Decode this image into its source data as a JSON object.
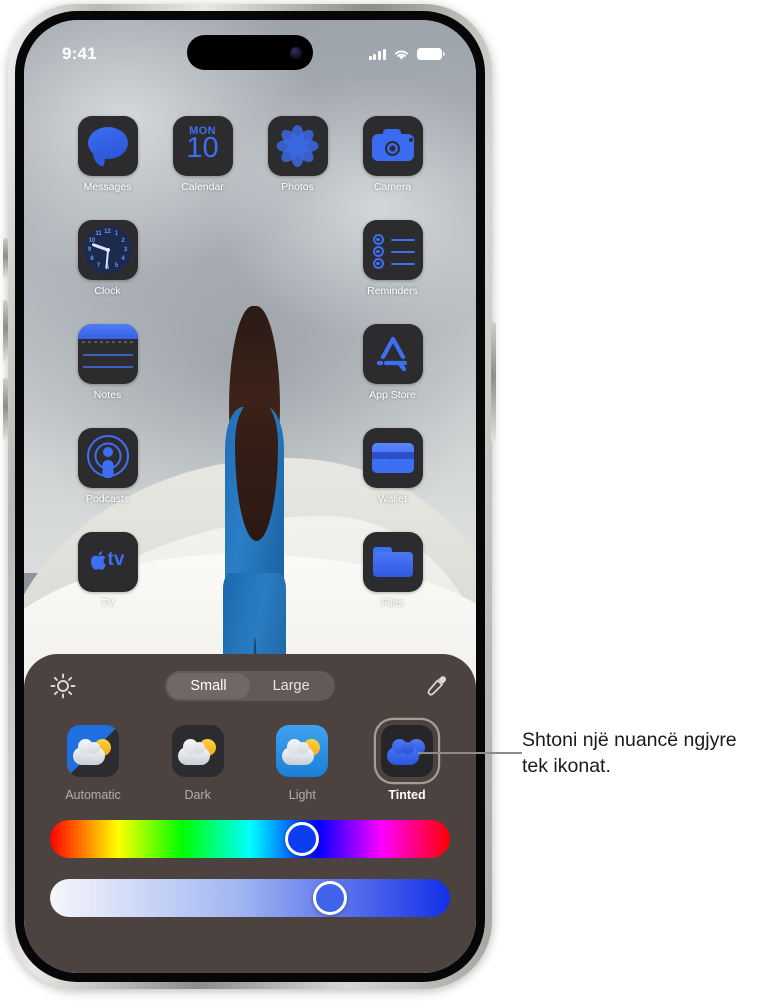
{
  "status_bar": {
    "time": "9:41",
    "signal_icon": "cellular-signal-icon",
    "wifi_icon": "wifi-icon",
    "battery_icon": "battery-icon"
  },
  "home_screen": {
    "apps": [
      {
        "label": "Messages",
        "icon": "messages-icon",
        "empty": false
      },
      {
        "label": "Calendar",
        "icon": "calendar-icon",
        "empty": false,
        "weekday": "MON",
        "day": "10"
      },
      {
        "label": "Photos",
        "icon": "photos-icon",
        "empty": false
      },
      {
        "label": "Camera",
        "icon": "camera-icon",
        "empty": false
      },
      {
        "label": "Clock",
        "icon": "clock-icon",
        "empty": false
      },
      {
        "label": "",
        "icon": "",
        "empty": true
      },
      {
        "label": "",
        "icon": "",
        "empty": true
      },
      {
        "label": "Reminders",
        "icon": "reminders-icon",
        "empty": false
      },
      {
        "label": "Notes",
        "icon": "notes-icon",
        "empty": false
      },
      {
        "label": "",
        "icon": "",
        "empty": true
      },
      {
        "label": "",
        "icon": "",
        "empty": true
      },
      {
        "label": "App Store",
        "icon": "app-store-icon",
        "empty": false
      },
      {
        "label": "Podcasts",
        "icon": "podcasts-icon",
        "empty": false
      },
      {
        "label": "",
        "icon": "",
        "empty": true
      },
      {
        "label": "",
        "icon": "",
        "empty": true
      },
      {
        "label": "Wallet",
        "icon": "wallet-icon",
        "empty": false
      },
      {
        "label": "TV",
        "icon": "tv-icon",
        "empty": false
      },
      {
        "label": "",
        "icon": "",
        "empty": true
      },
      {
        "label": "",
        "icon": "",
        "empty": true
      },
      {
        "label": "Files",
        "icon": "files-icon",
        "empty": false
      }
    ],
    "clock_numerals": [
      "12",
      "1",
      "2",
      "3",
      "4",
      "5",
      "6",
      "7",
      "8",
      "9",
      "10",
      "11"
    ]
  },
  "appearance_sheet": {
    "brightness_icon": "brightness-sun-icon",
    "eyedropper_icon": "eyedropper-icon",
    "size_segmented": {
      "options": [
        "Small",
        "Large"
      ],
      "selected": "Small"
    },
    "modes": [
      {
        "label": "Automatic",
        "selected": false
      },
      {
        "label": "Dark",
        "selected": false
      },
      {
        "label": "Light",
        "selected": false
      },
      {
        "label": "Tinted",
        "selected": true
      }
    ],
    "hue_slider": {
      "name": "hue-slider",
      "value_percent": 63
    },
    "intensity_slider": {
      "name": "intensity-slider",
      "value_percent": 70
    }
  },
  "callout": {
    "text": "Shtoni një nuancë ngjyre tek ikonat."
  }
}
